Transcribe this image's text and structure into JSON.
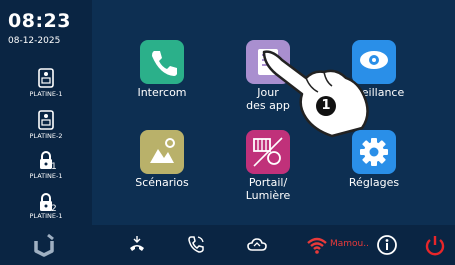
{
  "status": {
    "time": "08:23",
    "date": "08-12-2025"
  },
  "sidebar": {
    "items": [
      {
        "label": "PLATINE-1",
        "number": ""
      },
      {
        "label": "PLATINE-2",
        "number": ""
      },
      {
        "label": "PLATINE-1",
        "number": "1"
      },
      {
        "label": "PLATINE-1",
        "number": "2"
      }
    ]
  },
  "apps": [
    {
      "label": "Intercom",
      "color": "#2bb08a",
      "icon": "phone-icon"
    },
    {
      "label": "Jour\ndes app",
      "color": "#a98fcf",
      "icon": "journal-icon"
    },
    {
      "label": "urveillance",
      "color": "#2a8fe8",
      "icon": "eye-icon"
    },
    {
      "label": "Scénarios",
      "color": "#b9b16a",
      "icon": "scene-icon"
    },
    {
      "label": "Portail/\nLumière",
      "color": "#c0317a",
      "icon": "gate-light-icon"
    },
    {
      "label": "Réglages",
      "color": "#2a8fe8",
      "icon": "gear-icon"
    }
  ],
  "annotation": {
    "marker": "1"
  },
  "bottom_bar": {
    "wifi_label": "Mamou.."
  }
}
